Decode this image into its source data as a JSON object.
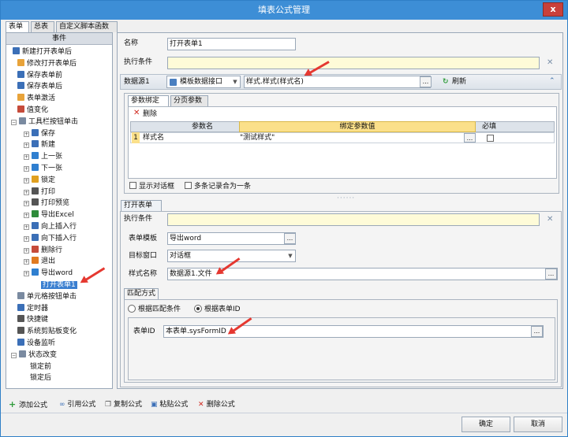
{
  "window": {
    "title": "填表公式管理",
    "close_label": "x"
  },
  "tabs": [
    "表单",
    "总表",
    "自定义脚本函数"
  ],
  "events": {
    "header": "事件",
    "items": [
      {
        "label": "新建打开表单后",
        "color": "#3b6fb7"
      },
      {
        "label": "修改打开表单后",
        "color": "#e8a33a"
      },
      {
        "label": "保存表单前",
        "color": "#3b6fb7"
      },
      {
        "label": "保存表单后",
        "color": "#3b6fb7"
      },
      {
        "label": "表单激活",
        "color": "#e8a33a"
      },
      {
        "label": "值变化",
        "color": "#c64b3a"
      },
      {
        "label": "工具栏按钮单击",
        "color": "#7a8aa0"
      },
      {
        "label": "保存",
        "color": "#3b6fb7"
      },
      {
        "label": "新建",
        "color": "#3b6fb7"
      },
      {
        "label": "上一张",
        "color": "#2f7fd0"
      },
      {
        "label": "下一张",
        "color": "#2f7fd0"
      },
      {
        "label": "锁定",
        "color": "#e0a020"
      },
      {
        "label": "打印",
        "color": "#555555"
      },
      {
        "label": "打印预览",
        "color": "#555555"
      },
      {
        "label": "导出Excel",
        "color": "#2e8b3a"
      },
      {
        "label": "向上插入行",
        "color": "#3b6fb7"
      },
      {
        "label": "向下插入行",
        "color": "#3b6fb7"
      },
      {
        "label": "删除行",
        "color": "#c64b3a"
      },
      {
        "label": "退出",
        "color": "#e07a20"
      },
      {
        "label": "导出word",
        "color": "#2f7fd0"
      },
      {
        "label": "打开表单1",
        "color": ""
      },
      {
        "label": "单元格按钮单击",
        "color": "#7a8aa0"
      },
      {
        "label": "定时器",
        "color": "#3b6fb7"
      },
      {
        "label": "快捷键",
        "color": "#555555"
      },
      {
        "label": "系统剪贴板变化",
        "color": "#555555"
      },
      {
        "label": "设备监听",
        "color": "#3b6fb7"
      },
      {
        "label": "状态改变",
        "color": "#7a8aa0"
      },
      {
        "label": "锁定前",
        "color": ""
      },
      {
        "label": "锁定后",
        "color": ""
      }
    ]
  },
  "form": {
    "name_label": "名称",
    "name_value": "打开表单1",
    "cond_label": "执行条件",
    "cond_value": "",
    "ds_label": "数据源1",
    "ds_type": "模板数据接口",
    "ds_value": "样式.样式(样式名)",
    "refresh_label": "刷新",
    "subtabs": [
      "参数绑定",
      "分页参数"
    ],
    "delete_label": "删除",
    "grid_headers": [
      "参数名",
      "绑定参数值",
      "必填"
    ],
    "grid_row": {
      "num": "1",
      "name": "样式名",
      "value": "\"测试样式\""
    },
    "show_dialog_label": "显示对话框",
    "merge_label": "多条记录合为一条",
    "open_form_tab": "打开表单",
    "cond2_label": "执行条件",
    "cond2_value": "",
    "template_label": "表单模板",
    "template_value": "导出word",
    "target_label": "目标窗口",
    "target_value": "对话框",
    "style_label": "样式名称",
    "style_value": "数据源1.文件",
    "match_tab": "匹配方式",
    "radio1": "根据匹配条件",
    "radio2": "根据表单ID",
    "formid_label": "表单ID",
    "formid_value": "本表单.sysFormID"
  },
  "toolbar": {
    "add": "添加公式",
    "ref": "引用公式",
    "copy": "复制公式",
    "paste": "粘贴公式",
    "delete": "删除公式"
  },
  "buttons": {
    "ok": "确定",
    "cancel": "取消"
  },
  "dots": "...",
  "accent": "#3d8ed6"
}
